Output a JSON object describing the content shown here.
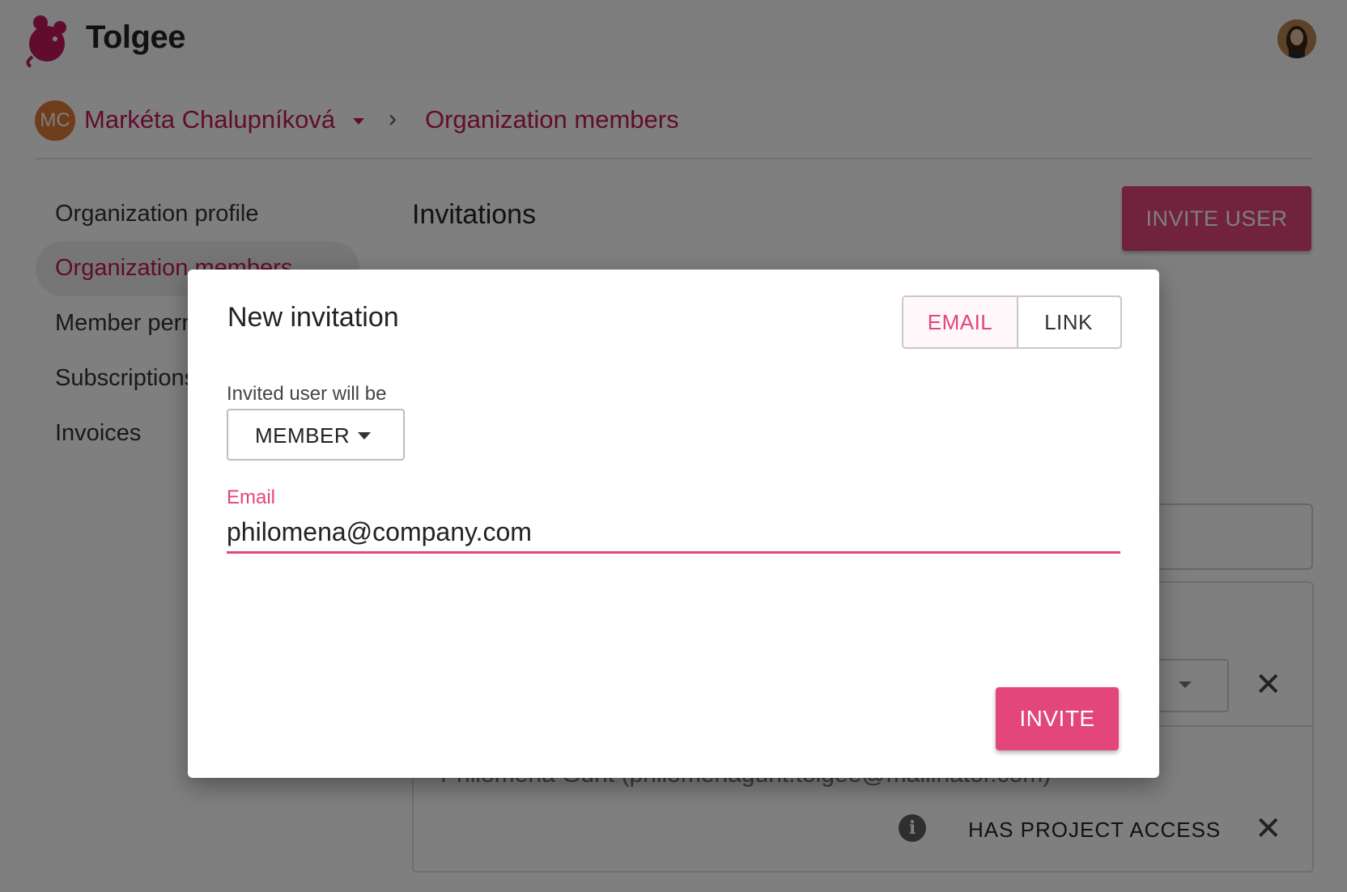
{
  "app": {
    "brand": "Tolgee"
  },
  "breadcrumb": {
    "org_initials": "MC",
    "org_name": "Markéta Chalupníková",
    "separator": "›",
    "page": "Organization members"
  },
  "sidebar": {
    "items": [
      {
        "label": "Organization profile"
      },
      {
        "label": "Organization members"
      },
      {
        "label": "Member permissions"
      },
      {
        "label": "Subscriptions"
      },
      {
        "label": "Invoices"
      }
    ]
  },
  "main": {
    "title": "Invitations",
    "invite_user_label": "INVITE USER",
    "invited_user_text": "Philomena Gunt (philomenagunt.tolgee@mailinator.com)",
    "has_project_access": "HAS PROJECT ACCESS",
    "info_glyph": "i",
    "close_glyph": "✕"
  },
  "dialog": {
    "title": "New invitation",
    "tabs": {
      "email": "EMAIL",
      "link": "LINK"
    },
    "role_label": "Invited user will be",
    "role_value": "MEMBER",
    "email_label": "Email",
    "email_value": "philomena@company.com",
    "invite_label": "INVITE"
  },
  "colors": {
    "accent": "#e2467a",
    "brand": "#c2185b",
    "org_avatar": "#e07b39"
  },
  "icons": [
    "tolgee-logo-icon",
    "user-avatar",
    "chevron-right-icon",
    "caret-down-icon",
    "close-icon",
    "info-icon"
  ]
}
